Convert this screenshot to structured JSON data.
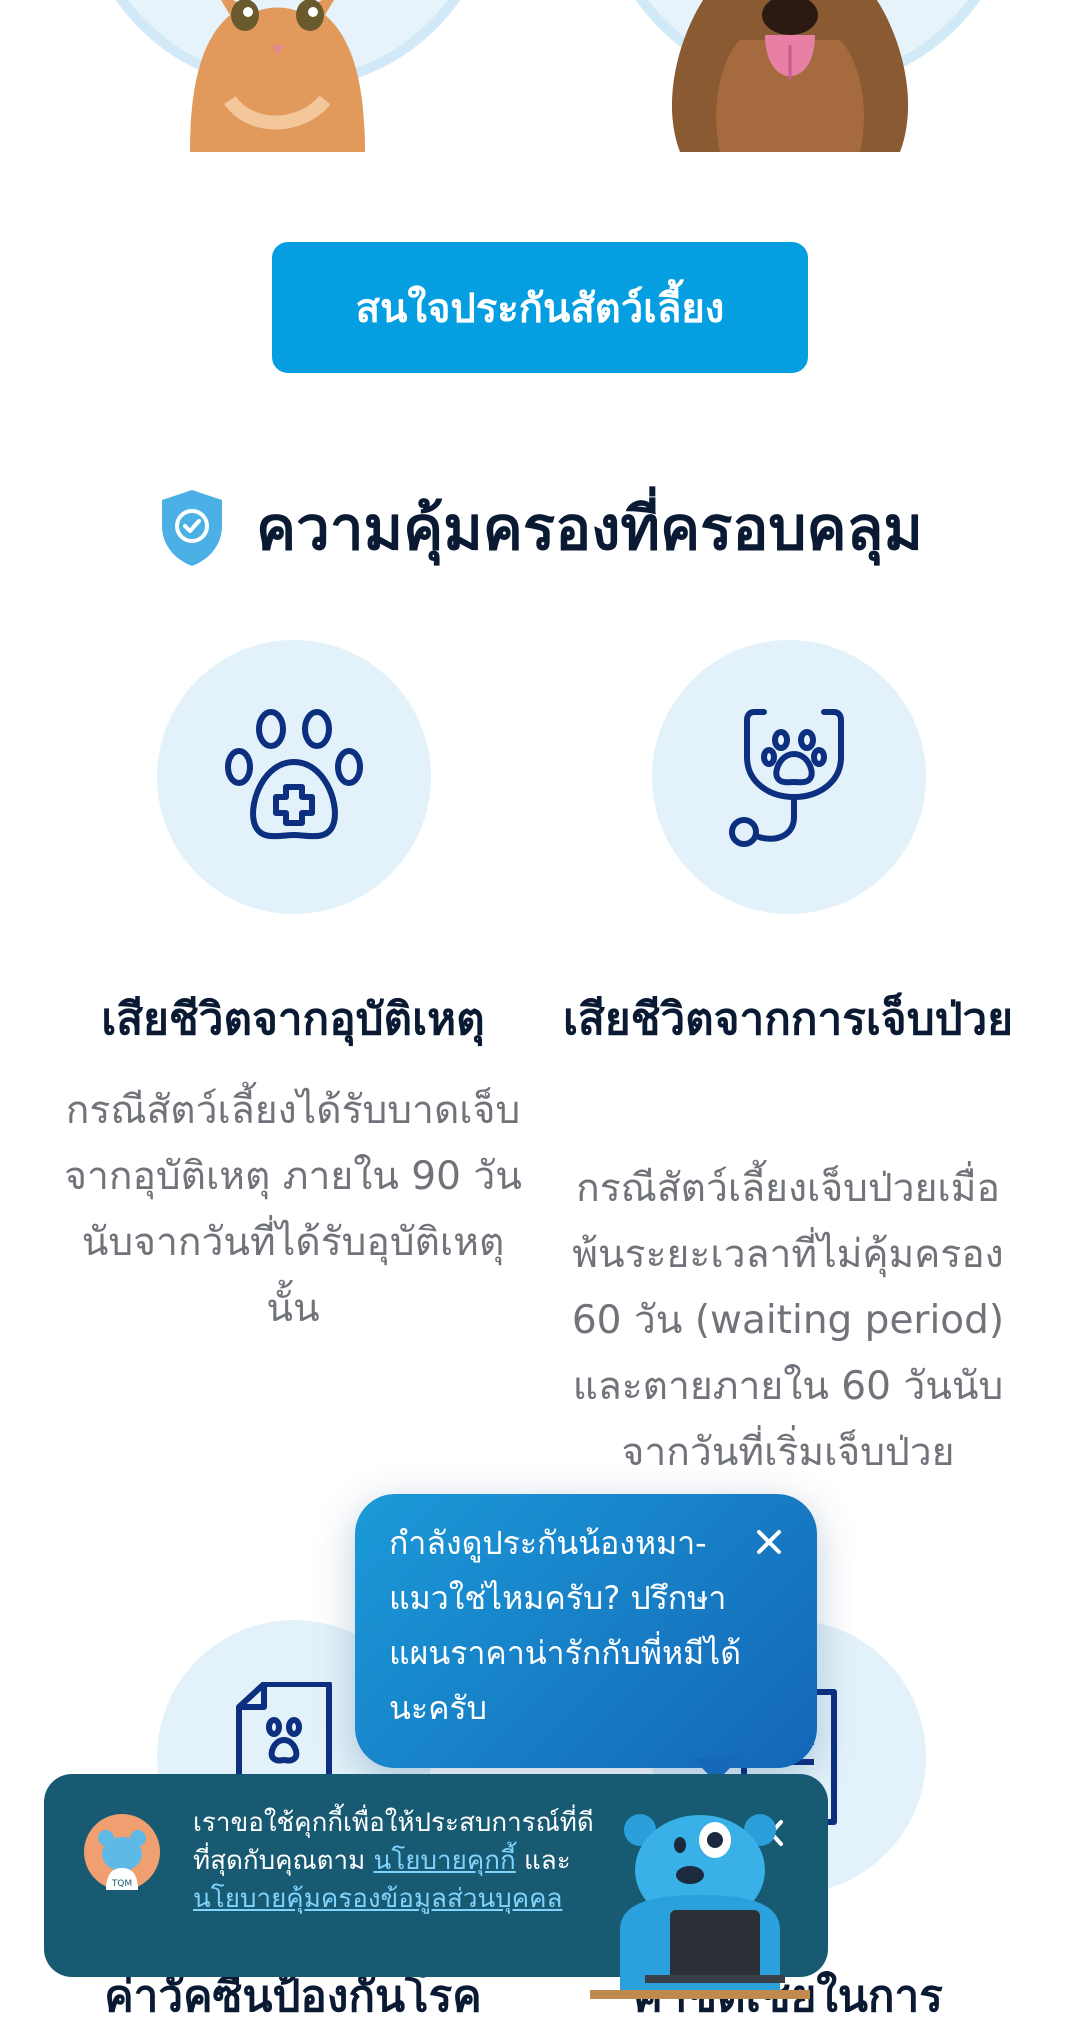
{
  "cta": {
    "label": "สนใจประกันสัตว์เลี้ยง"
  },
  "section": {
    "title": "ความคุ้มครองที่ครอบคลุม"
  },
  "cards": [
    {
      "title": "เสียชีวิตจากอุบัติเหตุ",
      "desc": "กรณีสัตว์เลี้ยงได้รับบาดเจ็บจากอุบัติเหตุ ภายใน 90 วันนับจากวันที่ได้รับอุบัติเหตุนั้น"
    },
    {
      "title": "เสียชีวิตจากการเจ็บป่วย",
      "desc": "กรณีสัตว์เลี้ยงเจ็บป่วยเมื่อพ้นระยะเวลาที่ไม่คุ้มครอง 60 วัน (waiting period) และตายภายใน 60 วันนับจากวันที่เริ่มเจ็บป่วย"
    }
  ],
  "bottom_cards": [
    {
      "title": "ค่าวัคซีนป้องกันโรค"
    },
    {
      "title": "ค่าชดเชยในการ"
    }
  ],
  "chat": {
    "message": "กำลังดูประกันน้องหมา-แมวใช่ไหมครับ? ปรึกษาแผนราคาน่ารักกับพี่หมีได้นะครับ"
  },
  "cookie": {
    "text_1": "เราขอใช้คุกกี้เพื่อให้ประสบการณ์ที่ดีที่สุดกับคุณตาม ",
    "link_1": "นโยบายคุกกี้",
    "text_2": " และ ",
    "link_2": "นโยบายคุ้มครองข้อมูลส่วนบุคคล",
    "avatar_badge": "TQM"
  },
  "colors": {
    "accent": "#059ee0",
    "icon_stroke": "#0d2f80",
    "icon_bg": "#e3f2fa",
    "shield": "#4ab0e6",
    "cookie_bg": "#185a72"
  },
  "icons": {
    "shield": "shield-check-icon",
    "paw_medical": "paw-medical-icon",
    "stethoscope": "stethoscope-paw-icon",
    "document": "pet-document-icon",
    "receipt": "receipt-icon",
    "close": "close-icon",
    "chevron": "chevron-left-icon"
  }
}
